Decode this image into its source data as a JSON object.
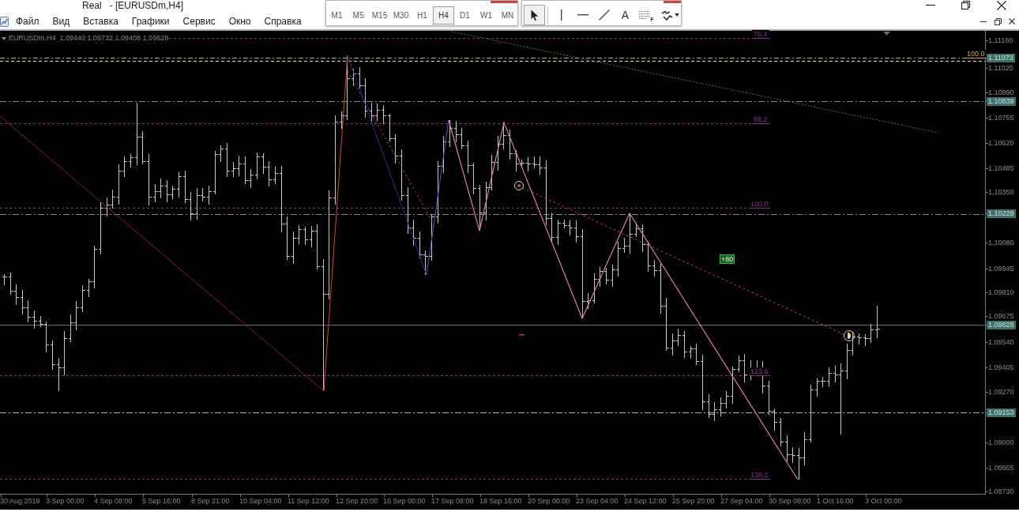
{
  "window": {
    "title": "Real   - [EURUSDm,H4]"
  },
  "menu": [
    "Файл",
    "Вид",
    "Вставка",
    "Графики",
    "Сервис",
    "Окно",
    "Справка"
  ],
  "timeframe_toolbar": {
    "buttons": [
      {
        "label": "M1",
        "selected": false
      },
      {
        "label": "M5",
        "selected": false
      },
      {
        "label": "M15",
        "selected": false
      },
      {
        "label": "M30",
        "selected": false
      },
      {
        "label": "H1",
        "selected": false
      },
      {
        "label": "H4",
        "selected": true
      },
      {
        "label": "D1",
        "selected": false
      },
      {
        "label": "W1",
        "selected": false
      },
      {
        "label": "MN",
        "selected": false
      }
    ]
  },
  "drawing_toolbar": {
    "tools": [
      {
        "kind": "cursor",
        "selected": true
      },
      {
        "kind": "vertical_line",
        "selected": false
      },
      {
        "kind": "horizontal_line",
        "selected": false
      },
      {
        "kind": "trend_line",
        "selected": false
      },
      {
        "kind": "text",
        "glyph": "A",
        "selected": false
      },
      {
        "kind": "fibonacci",
        "glyph": "F",
        "selected": false
      },
      {
        "kind": "arrows",
        "selected": false
      }
    ]
  },
  "chart": {
    "symbol": "EURUSDm,H4",
    "quote": "1.09440 1.09732 1.09408 1.09628",
    "fib_levels": [
      {
        "label": "76.4",
        "color": "#8b2f8b"
      },
      {
        "label": "100.0",
        "color": "#c8a46a"
      },
      {
        "label": "88.2",
        "color": "#8b2f8b"
      },
      {
        "label": "100.0",
        "color": "#8b2f8b"
      },
      {
        "label": "123.6",
        "color": "#8b2f8b"
      },
      {
        "label": "138.2",
        "color": "#8b2f8b"
      }
    ],
    "profit_label": "+80",
    "price_axis": [
      {
        "text": "1.11160",
        "highlighted": false
      },
      {
        "text": "1.11073",
        "highlighted": true
      },
      {
        "text": "1.11025",
        "highlighted": false
      },
      {
        "text": "1.10890",
        "highlighted": false
      },
      {
        "text": "1.10839",
        "highlighted": true
      },
      {
        "text": "1.10755",
        "highlighted": false
      },
      {
        "text": "1.10620",
        "highlighted": false
      },
      {
        "text": "1.10485",
        "highlighted": false
      },
      {
        "text": "1.10350",
        "highlighted": false
      },
      {
        "text": "1.10229",
        "highlighted": true
      },
      {
        "text": "1.10080",
        "highlighted": false
      },
      {
        "text": "1.09945",
        "highlighted": false
      },
      {
        "text": "1.09810",
        "highlighted": false
      },
      {
        "text": "1.09675",
        "highlighted": false
      },
      {
        "text": "1.09628",
        "highlighted": true
      },
      {
        "text": "1.09540",
        "highlighted": false
      },
      {
        "text": "1.09405",
        "highlighted": false
      },
      {
        "text": "1.09270",
        "highlighted": false
      },
      {
        "text": "1.09153",
        "highlighted": true
      },
      {
        "text": "1.09000",
        "highlighted": false
      },
      {
        "text": "1.08865",
        "highlighted": false
      },
      {
        "text": "1.08730",
        "highlighted": false
      }
    ],
    "time_axis": [
      "30 Aug 2019",
      "3 Sep 00:00",
      "4 Sep 08:00",
      "5 Sep 16:00",
      "8 Sep 21:00",
      "10 Sep 04:00",
      "11 Sep 12:00",
      "12 Sep 20:00",
      "16 Sep 00:00",
      "17 Sep 08:00",
      "18 Sep 16:00",
      "20 Sep 00:00",
      "23 Sep 04:00",
      "24 Sep 12:00",
      "25 Sep 20:00",
      "27 Sep 04:00",
      "30 Sep 08:00",
      "1 Oct 16:00",
      "3 Oct 00:00"
    ]
  }
}
